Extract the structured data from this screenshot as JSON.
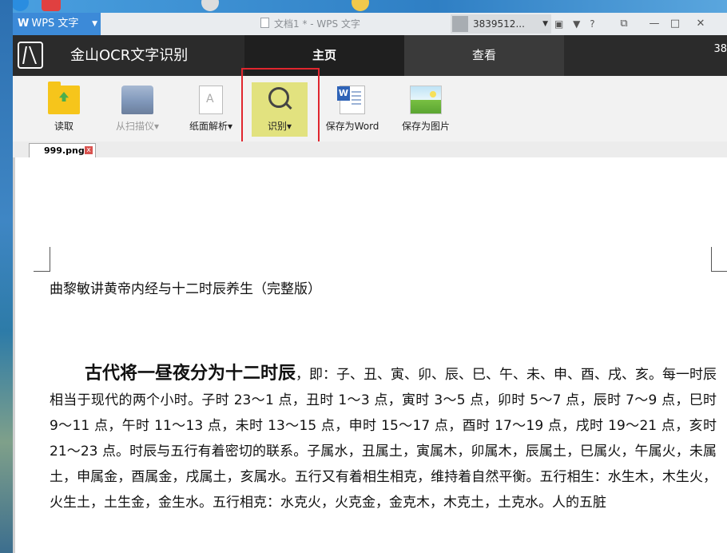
{
  "taskbar": {
    "icons": [
      "ie-icon",
      "app-icon",
      "chrome-icon",
      "folder-icon"
    ]
  },
  "titlebar": {
    "app_label": "WPS 文字",
    "document_title": "文档1 * - WPS 文字",
    "user_name": "3839512...",
    "help_label": "?"
  },
  "ocr": {
    "app_title": "金山OCR文字识别",
    "tabs": [
      {
        "label": "主页",
        "active": true
      },
      {
        "label": "查看",
        "active": false
      }
    ],
    "header_number": "38"
  },
  "ribbon": {
    "buttons": [
      {
        "label": "读取",
        "icon": "folder-open-icon",
        "enabled": true
      },
      {
        "label": "从扫描仪",
        "icon": "scanner-icon",
        "enabled": false,
        "dropdown": true
      },
      {
        "label": "纸面解析",
        "icon": "page-layout-icon",
        "enabled": true,
        "dropdown": true
      },
      {
        "label": "识别",
        "icon": "magnifier-icon",
        "enabled": true,
        "dropdown": true,
        "active": true
      },
      {
        "label": "保存为Word",
        "icon": "word-doc-icon",
        "enabled": true
      },
      {
        "label": "保存为图片",
        "icon": "image-icon",
        "enabled": true
      }
    ],
    "highlight_color": "#e0262e"
  },
  "document_tab": {
    "name": "999.png"
  },
  "document": {
    "heading": "曲黎敏讲黄帝内经与十二时辰养生（完整版）",
    "lead": "古代将一昼夜分为十二时辰",
    "body": "，即：子、丑、寅、卯、辰、巳、午、未、申、酉、戌、亥。每一时辰相当于现代的两个小时。子时 23～1 点，丑时 1～3 点，寅时 3～5 点，卯时 5～7 点，辰时 7～9 点，巳时 9～11 点，午时 11～13 点，未时 13～15 点，申时 15～17 点，酉时 17～19 点，戌时 19～21 点，亥时 21～23 点。时辰与五行有着密切的联系。子属水，丑属土，寅属木，卯属木，辰属土，巳属火，午属火，未属土，申属金，酉属金，戌属土，亥属水。五行又有着相生相克，维持着自然平衡。五行相生：水生木，木生火，火生土，土生金，金生水。五行相克：水克火，火克金，金克木，木克土，土克水。人的五脏"
  },
  "colors": {
    "ocr_header": "#2b2b2b",
    "wps_blue": "#3c8ad8",
    "active_button": "#e2e27f"
  }
}
